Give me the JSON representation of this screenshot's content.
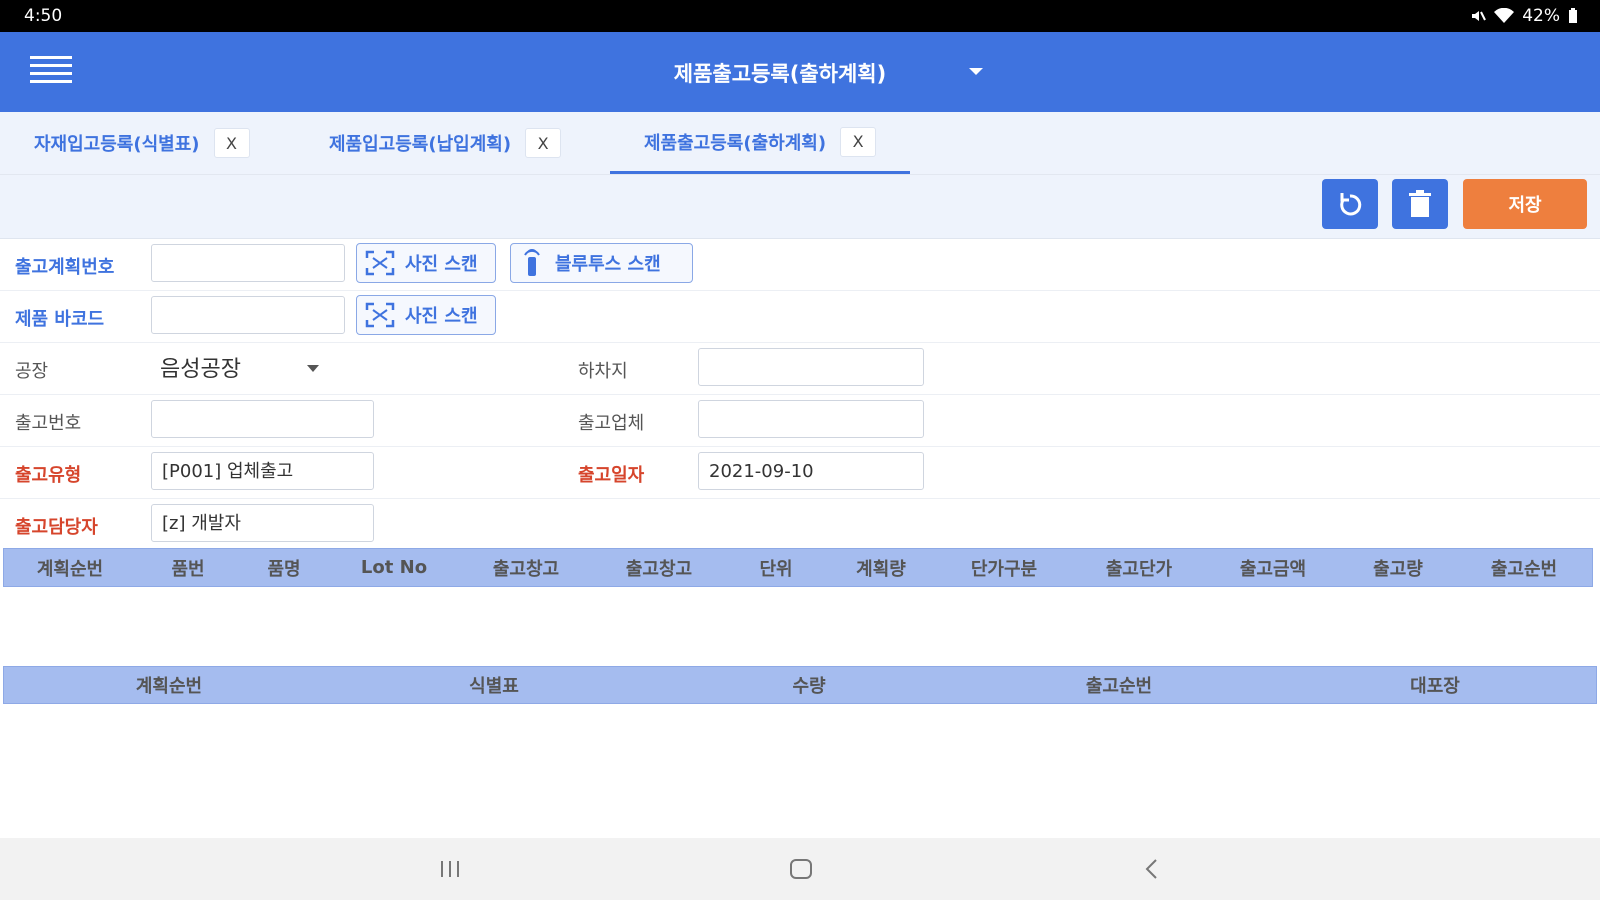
{
  "status_bar": {
    "time": "4:50",
    "battery": "42%"
  },
  "app_bar": {
    "title": "제품출고등록(출하계획)"
  },
  "tabs": [
    {
      "label": "자재입고등록(식별표)",
      "close": "X"
    },
    {
      "label": "제품입고등록(납입계획)",
      "close": "X"
    },
    {
      "label": "제품출고등록(출하계획)",
      "close": "X"
    }
  ],
  "toolbar": {
    "save_label": "저장"
  },
  "form": {
    "plan_no_label": "출고계획번호",
    "plan_no_value": "",
    "photo_scan_label": "사진 스캔",
    "bluetooth_scan_label": "블루투스 스캔",
    "barcode_label": "제품 바코드",
    "barcode_value": "",
    "factory_label": "공장",
    "factory_value": "음성공장",
    "unload_label": "하차지",
    "unload_value": "",
    "ship_no_label": "출고번호",
    "ship_no_value": "",
    "ship_company_label": "출고업체",
    "ship_company_value": "",
    "ship_type_label": "출고유형",
    "ship_type_value": "[P001] 업체출고",
    "ship_date_label": "출고일자",
    "ship_date_value": "2021-09-10",
    "manager_label": "출고담당자",
    "manager_value": "[z] 개발자"
  },
  "grid1_columns": [
    "계획순번",
    "품번",
    "품명",
    "Lot No",
    "출고창고",
    "출고창고",
    "단위",
    "계획량",
    "단가구분",
    "출고단가",
    "출고금액",
    "출고량",
    "출고순번"
  ],
  "grid2_columns": [
    "계획순번",
    "식별표",
    "수량",
    "출고순번",
    "대포장"
  ],
  "colors": {
    "primary": "#3f73df",
    "accent": "#ee7f3e",
    "required": "#d6452c",
    "grid_header": "#a5bcef"
  }
}
